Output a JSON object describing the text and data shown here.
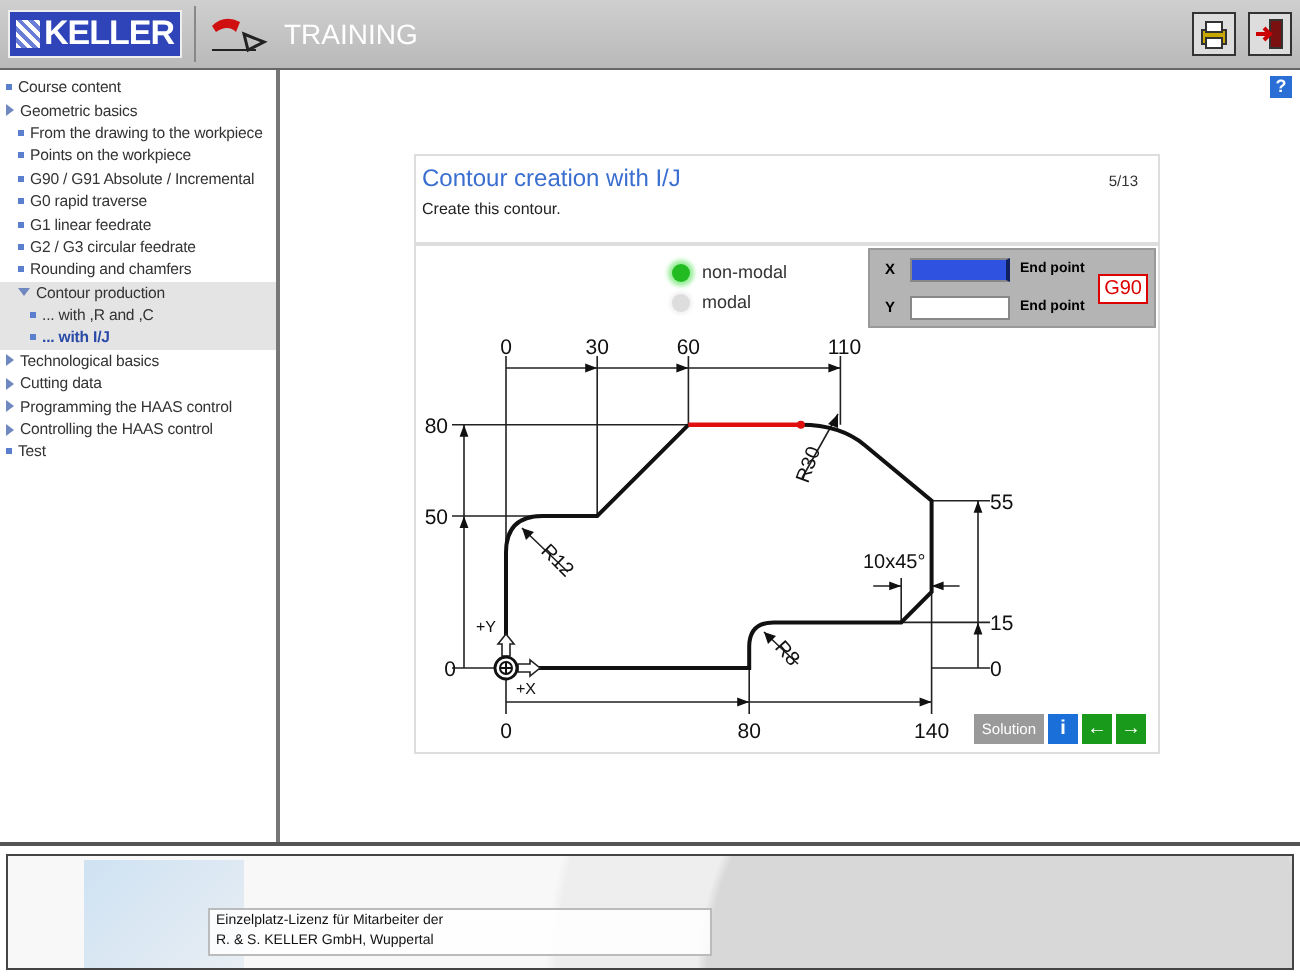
{
  "header": {
    "logo": "KELLER",
    "title": "TRAINING"
  },
  "sidebar": {
    "items": [
      {
        "label": "Course content",
        "kind": "page",
        "selected": false
      },
      {
        "label": "Geometric basics",
        "kind": "folder",
        "expanded": false,
        "selected": false,
        "children": [
          {
            "label": "From the drawing to the workpiece",
            "kind": "page",
            "selected": false
          },
          {
            "label": "Points on the workpiece",
            "kind": "page",
            "selected": false
          },
          {
            "label": "G90 / G91  Absolute / Incremental",
            "kind": "page",
            "selected": false
          },
          {
            "label": "G0 rapid traverse",
            "kind": "page",
            "selected": false
          },
          {
            "label": "G1 linear feedrate",
            "kind": "page",
            "selected": false
          },
          {
            "label": "G2 / G3  circular feedrate",
            "kind": "page",
            "selected": false
          },
          {
            "label": "Rounding and chamfers",
            "kind": "page",
            "selected": false
          },
          {
            "label": "Contour production",
            "kind": "folder",
            "expanded": true,
            "selected": false,
            "children": [
              {
                "label": "... with ,R and ,C",
                "kind": "page",
                "selected": false
              },
              {
                "label": "... with I/J",
                "kind": "page",
                "selected": true
              }
            ]
          }
        ]
      },
      {
        "label": "Technological basics",
        "kind": "folder",
        "expanded": false,
        "selected": false
      },
      {
        "label": "Cutting data",
        "kind": "folder",
        "expanded": false,
        "selected": false
      },
      {
        "label": "Programming the HAAS control",
        "kind": "folder",
        "expanded": false,
        "selected": false
      },
      {
        "label": "Controlling the HAAS control",
        "kind": "folder",
        "expanded": false,
        "selected": false
      },
      {
        "label": "Test",
        "kind": "page",
        "selected": false
      }
    ]
  },
  "help_button": "?",
  "lesson": {
    "title": "Contour creation with I/J",
    "page": "5/13",
    "instruction": "Create this contour.",
    "modes": [
      {
        "label": "non-modal",
        "selected": true
      },
      {
        "label": "modal",
        "selected": false
      }
    ],
    "inputs": [
      {
        "axis": "X",
        "hint": "End point",
        "focused": true
      },
      {
        "axis": "Y",
        "hint": "End point",
        "focused": false
      }
    ],
    "code_badge": "G90",
    "drawing": {
      "top_labels": [
        "0",
        "30",
        "60",
        "110"
      ],
      "left_labels": [
        "80",
        "50",
        "0"
      ],
      "right_labels": [
        "55",
        "15",
        "0"
      ],
      "bottom_labels": [
        "0",
        "80",
        "140"
      ],
      "annotations": [
        "R12",
        "R30",
        "R8",
        "10x45°"
      ],
      "axis_labels": [
        "+Y",
        "+X"
      ]
    },
    "buttons": [
      {
        "kind": "solution",
        "label": "Solution",
        "disabled": true
      },
      {
        "kind": "info",
        "label": "i",
        "disabled": false
      },
      {
        "kind": "back",
        "label": "←",
        "disabled": false
      },
      {
        "kind": "forward",
        "label": "→",
        "disabled": false
      }
    ]
  },
  "footer": {
    "license_lines": [
      "Einzelplatz-Lizenz für Mitarbeiter der",
      "R. & S. KELLER GmbH, Wuppertal"
    ]
  }
}
